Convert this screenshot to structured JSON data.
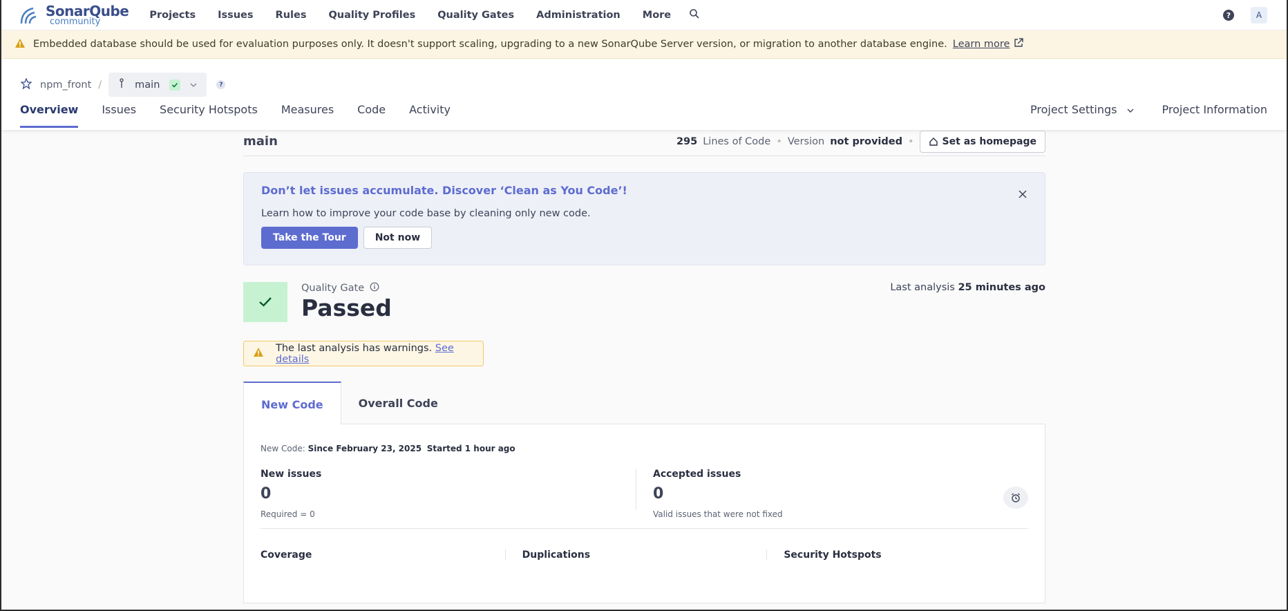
{
  "nav": {
    "logo_main": "SonarQube",
    "logo_sub": "community",
    "items": [
      "Projects",
      "Issues",
      "Rules",
      "Quality Profiles",
      "Quality Gates",
      "Administration",
      "More"
    ],
    "help": "?",
    "avatar": "A"
  },
  "banner": {
    "text": "Embedded database should be used for evaluation purposes only. It doesn't support scaling, upgrading to a new SonarQube Server version, or migration to another database engine.",
    "link": "Learn more"
  },
  "project": {
    "name": "npm_front",
    "branch": "main",
    "help": "?",
    "tabs": [
      "Overview",
      "Issues",
      "Security Hotspots",
      "Measures",
      "Code",
      "Activity"
    ],
    "settings": "Project Settings",
    "information": "Project Information"
  },
  "overview": {
    "branch_title": "main",
    "loc_value": "295",
    "loc_label": "Lines of Code",
    "version_label": "Version",
    "version_value": "not provided",
    "homepage_btn": "Set as homepage"
  },
  "promo": {
    "title": "Don’t let issues accumulate. Discover ‘Clean as You Code’!",
    "body": "Learn how to improve your code base by cleaning only new code.",
    "tour_btn": "Take the Tour",
    "dismiss_btn": "Not now"
  },
  "quality_gate": {
    "label": "Quality Gate",
    "status": "Passed",
    "last_analysis_label": "Last analysis",
    "last_analysis_value": "25 minutes ago"
  },
  "warning": {
    "text": "The last analysis has warnings.",
    "link": "See details"
  },
  "code_tabs": [
    "New Code",
    "Overall Code"
  ],
  "new_code": {
    "prefix": "New Code:",
    "since": "Since February 23, 2025",
    "started": "Started 1 hour ago",
    "new_issues_title": "New issues",
    "new_issues_value": "0",
    "new_issues_sub": "Required = 0",
    "accepted_title": "Accepted issues",
    "accepted_value": "0",
    "accepted_sub": "Valid issues that were not fixed",
    "metrics": [
      "Coverage",
      "Duplications",
      "Security Hotspots"
    ]
  },
  "colors": {
    "accent": "#5d6ccf",
    "passed_bg": "#c6f2d2",
    "warning_bg": "#fcf5e4"
  }
}
